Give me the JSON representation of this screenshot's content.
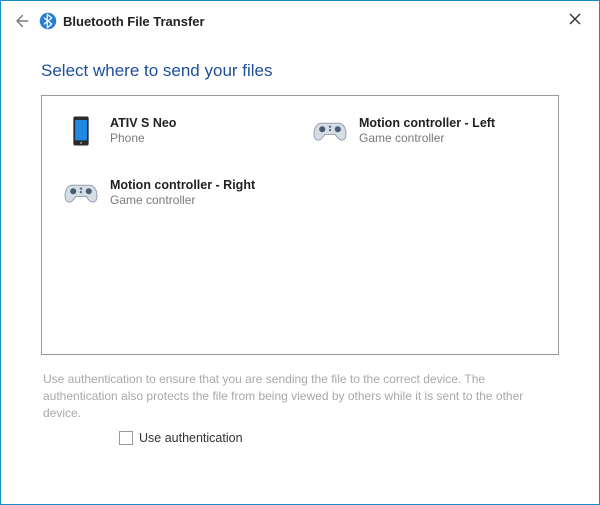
{
  "header": {
    "title": "Bluetooth File Transfer"
  },
  "instruction": "Select where to send your files",
  "devices": [
    {
      "name": "ATIV S Neo",
      "type": "Phone",
      "icon": "phone"
    },
    {
      "name": "Motion controller - Left",
      "type": "Game controller",
      "icon": "gamepad"
    },
    {
      "name": "Motion controller - Right",
      "type": "Game controller",
      "icon": "gamepad"
    }
  ],
  "auth": {
    "note": "Use authentication to ensure that you are sending the file to the correct device. The authentication also protects the file from being viewed by others while it is sent to the other device.",
    "checkbox_label": "Use authentication",
    "checked": false
  }
}
